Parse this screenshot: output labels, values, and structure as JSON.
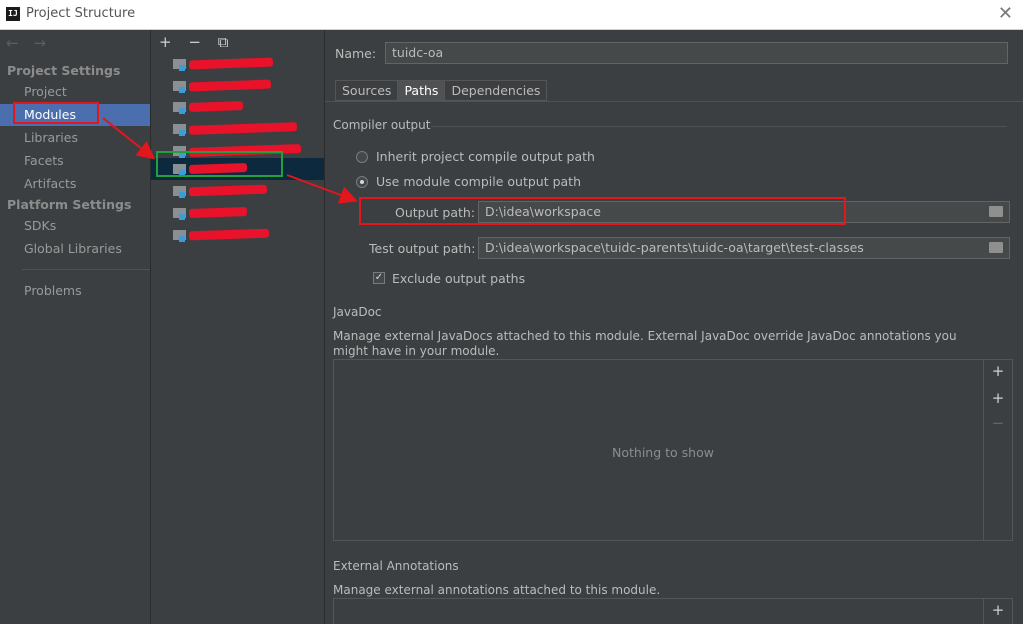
{
  "window": {
    "title": "Project Structure",
    "app_icon": "IJ",
    "close": "✕"
  },
  "nav": {
    "back": "←",
    "forward": "→",
    "project_settings": "Project Settings",
    "items_project": [
      "Project",
      "Modules",
      "Libraries",
      "Facets",
      "Artifacts"
    ],
    "platform_settings": "Platform Settings",
    "items_platform": [
      "SDKs",
      "Global Libraries"
    ],
    "problems": "Problems",
    "selected": "Modules"
  },
  "modules": {
    "toolbar": {
      "add": "+",
      "remove": "−",
      "copy": "⧉"
    },
    "selected_index": 4
  },
  "detail": {
    "name_label": "Name:",
    "name_value": "tuidc-oa",
    "tabs": [
      "Sources",
      "Paths",
      "Dependencies"
    ],
    "active_tab": "Paths",
    "compiler_output": "Compiler output",
    "inherit_label": "Inherit project compile output path",
    "use_module_label": "Use module compile output path",
    "output_path_label": "Output path:",
    "output_path_value": "D:\\idea\\workspace",
    "test_output_label": "Test output path:",
    "test_output_value": "D:\\idea\\workspace\\tuidc-parents\\tuidc-oa\\target\\test-classes",
    "exclude_label": "Exclude output paths",
    "javadoc_title": "JavaDoc",
    "javadoc_desc": "Manage external JavaDocs attached to this module. External JavaDoc override JavaDoc annotations you might have in your module.",
    "nothing_to_show": "Nothing to show",
    "ext_annotations_title": "External Annotations",
    "ext_annotations_desc": "Manage external annotations attached to this module.",
    "tool_add": "+",
    "tool_add_url": "+",
    "tool_remove": "−"
  },
  "colors": {
    "annotation_red": "#e3161e",
    "annotation_green": "#22a040",
    "selection_blue": "#4b6eaf"
  }
}
